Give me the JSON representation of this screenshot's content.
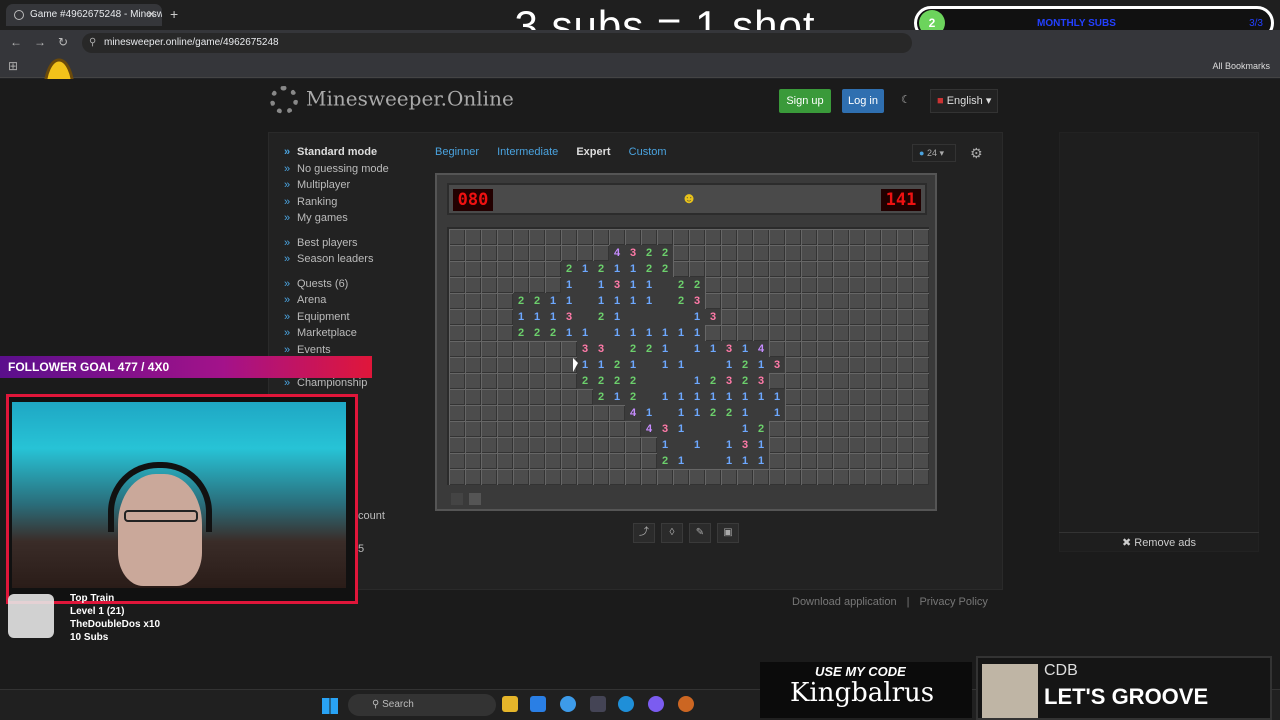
{
  "browser": {
    "tab_title": "Game #4962675248 - Minesw...",
    "url": "minesweeper.online/game/4962675248",
    "all_bookmarks": "All Bookmarks"
  },
  "stream": {
    "title": "3 subs = 1 shot",
    "subs_count": "2",
    "subs_label": "MONTHLY SUBS",
    "subs_target": "3/3",
    "follower_goal": "FOLLOWER GOAL 477 / 4X0",
    "train_title": "Top Train",
    "train_level": "Level 1 (21)",
    "train_user": "TheDoubleDos x10",
    "train_subs": "10 Subs",
    "code_line1": "USE MY CODE",
    "code_line2": "Kingbalrus",
    "song_artist": "CDB",
    "song_title": "LET'S GROOVE"
  },
  "site": {
    "logo": "Minesweeper.Online",
    "signup": "Sign up",
    "login": "Log in",
    "lang": "English",
    "zoom": "24",
    "download": "Download application",
    "privacy": "Privacy Policy",
    "remove_ads": "Remove ads"
  },
  "menu": [
    {
      "label": "Standard mode",
      "bold": true
    },
    {
      "label": "No guessing mode"
    },
    {
      "label": "Multiplayer"
    },
    {
      "label": "Ranking"
    },
    {
      "label": "My games"
    },
    {
      "gap": true
    },
    {
      "label": "Best players"
    },
    {
      "label": "Season leaders"
    },
    {
      "gap": true
    },
    {
      "label": "Quests (6)"
    },
    {
      "label": "Arena"
    },
    {
      "label": "Equipment"
    },
    {
      "label": "Marketplace"
    },
    {
      "label": "Events"
    },
    {
      "label": ""
    },
    {
      "label": "Championship"
    },
    {
      "label": "(961)"
    }
  ],
  "hidden_menu_fragments": [
    "count",
    "5"
  ],
  "levels": {
    "beginner": "Beginner",
    "intermediate": "Intermediate",
    "expert": "Expert",
    "custom": "Custom"
  },
  "game": {
    "mines_left": "080",
    "timer": "141",
    "cols": 30,
    "rows": 16,
    "board": [
      "..............................",
      "..........4322................",
      ".......2121122................",
      ".......1 1311 22..............",
      "....2211 1111 23..............",
      "....1113 21    13.............",
      "....22211 111111..............",
      "........33 221 11314..........",
      "........1121 11  1213.........",
      "........2222   12323..........",
      ".........212 11111111.........",
      "...........41 11221 1.........",
      "............431   12..........",
      ".............1 1 131..........",
      ".............21  111..........",
      ".............................."
    ]
  }
}
